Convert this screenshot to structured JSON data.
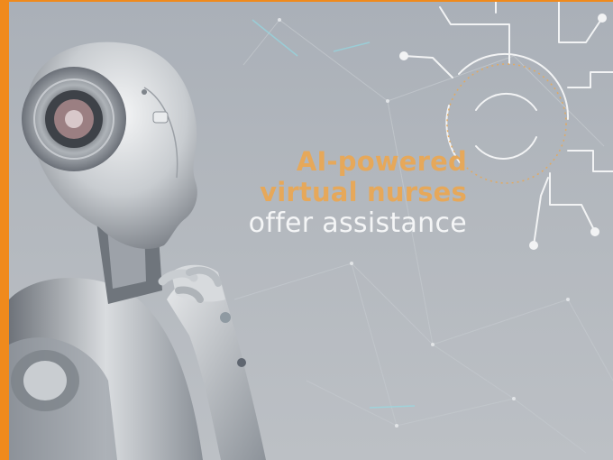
{
  "headline": {
    "line1": "AI-powered",
    "line2": "virtual nurses",
    "line3": "offer assistance"
  },
  "colors": {
    "frame": "#f08a1c",
    "background": "#b0b5bb",
    "highlight_text": "#e6a85a",
    "plain_text": "#f4f5f6",
    "circuit": "#f2f3f4"
  },
  "icons": {
    "robot": "robot-illustration",
    "circuit": "circuit-icon"
  }
}
